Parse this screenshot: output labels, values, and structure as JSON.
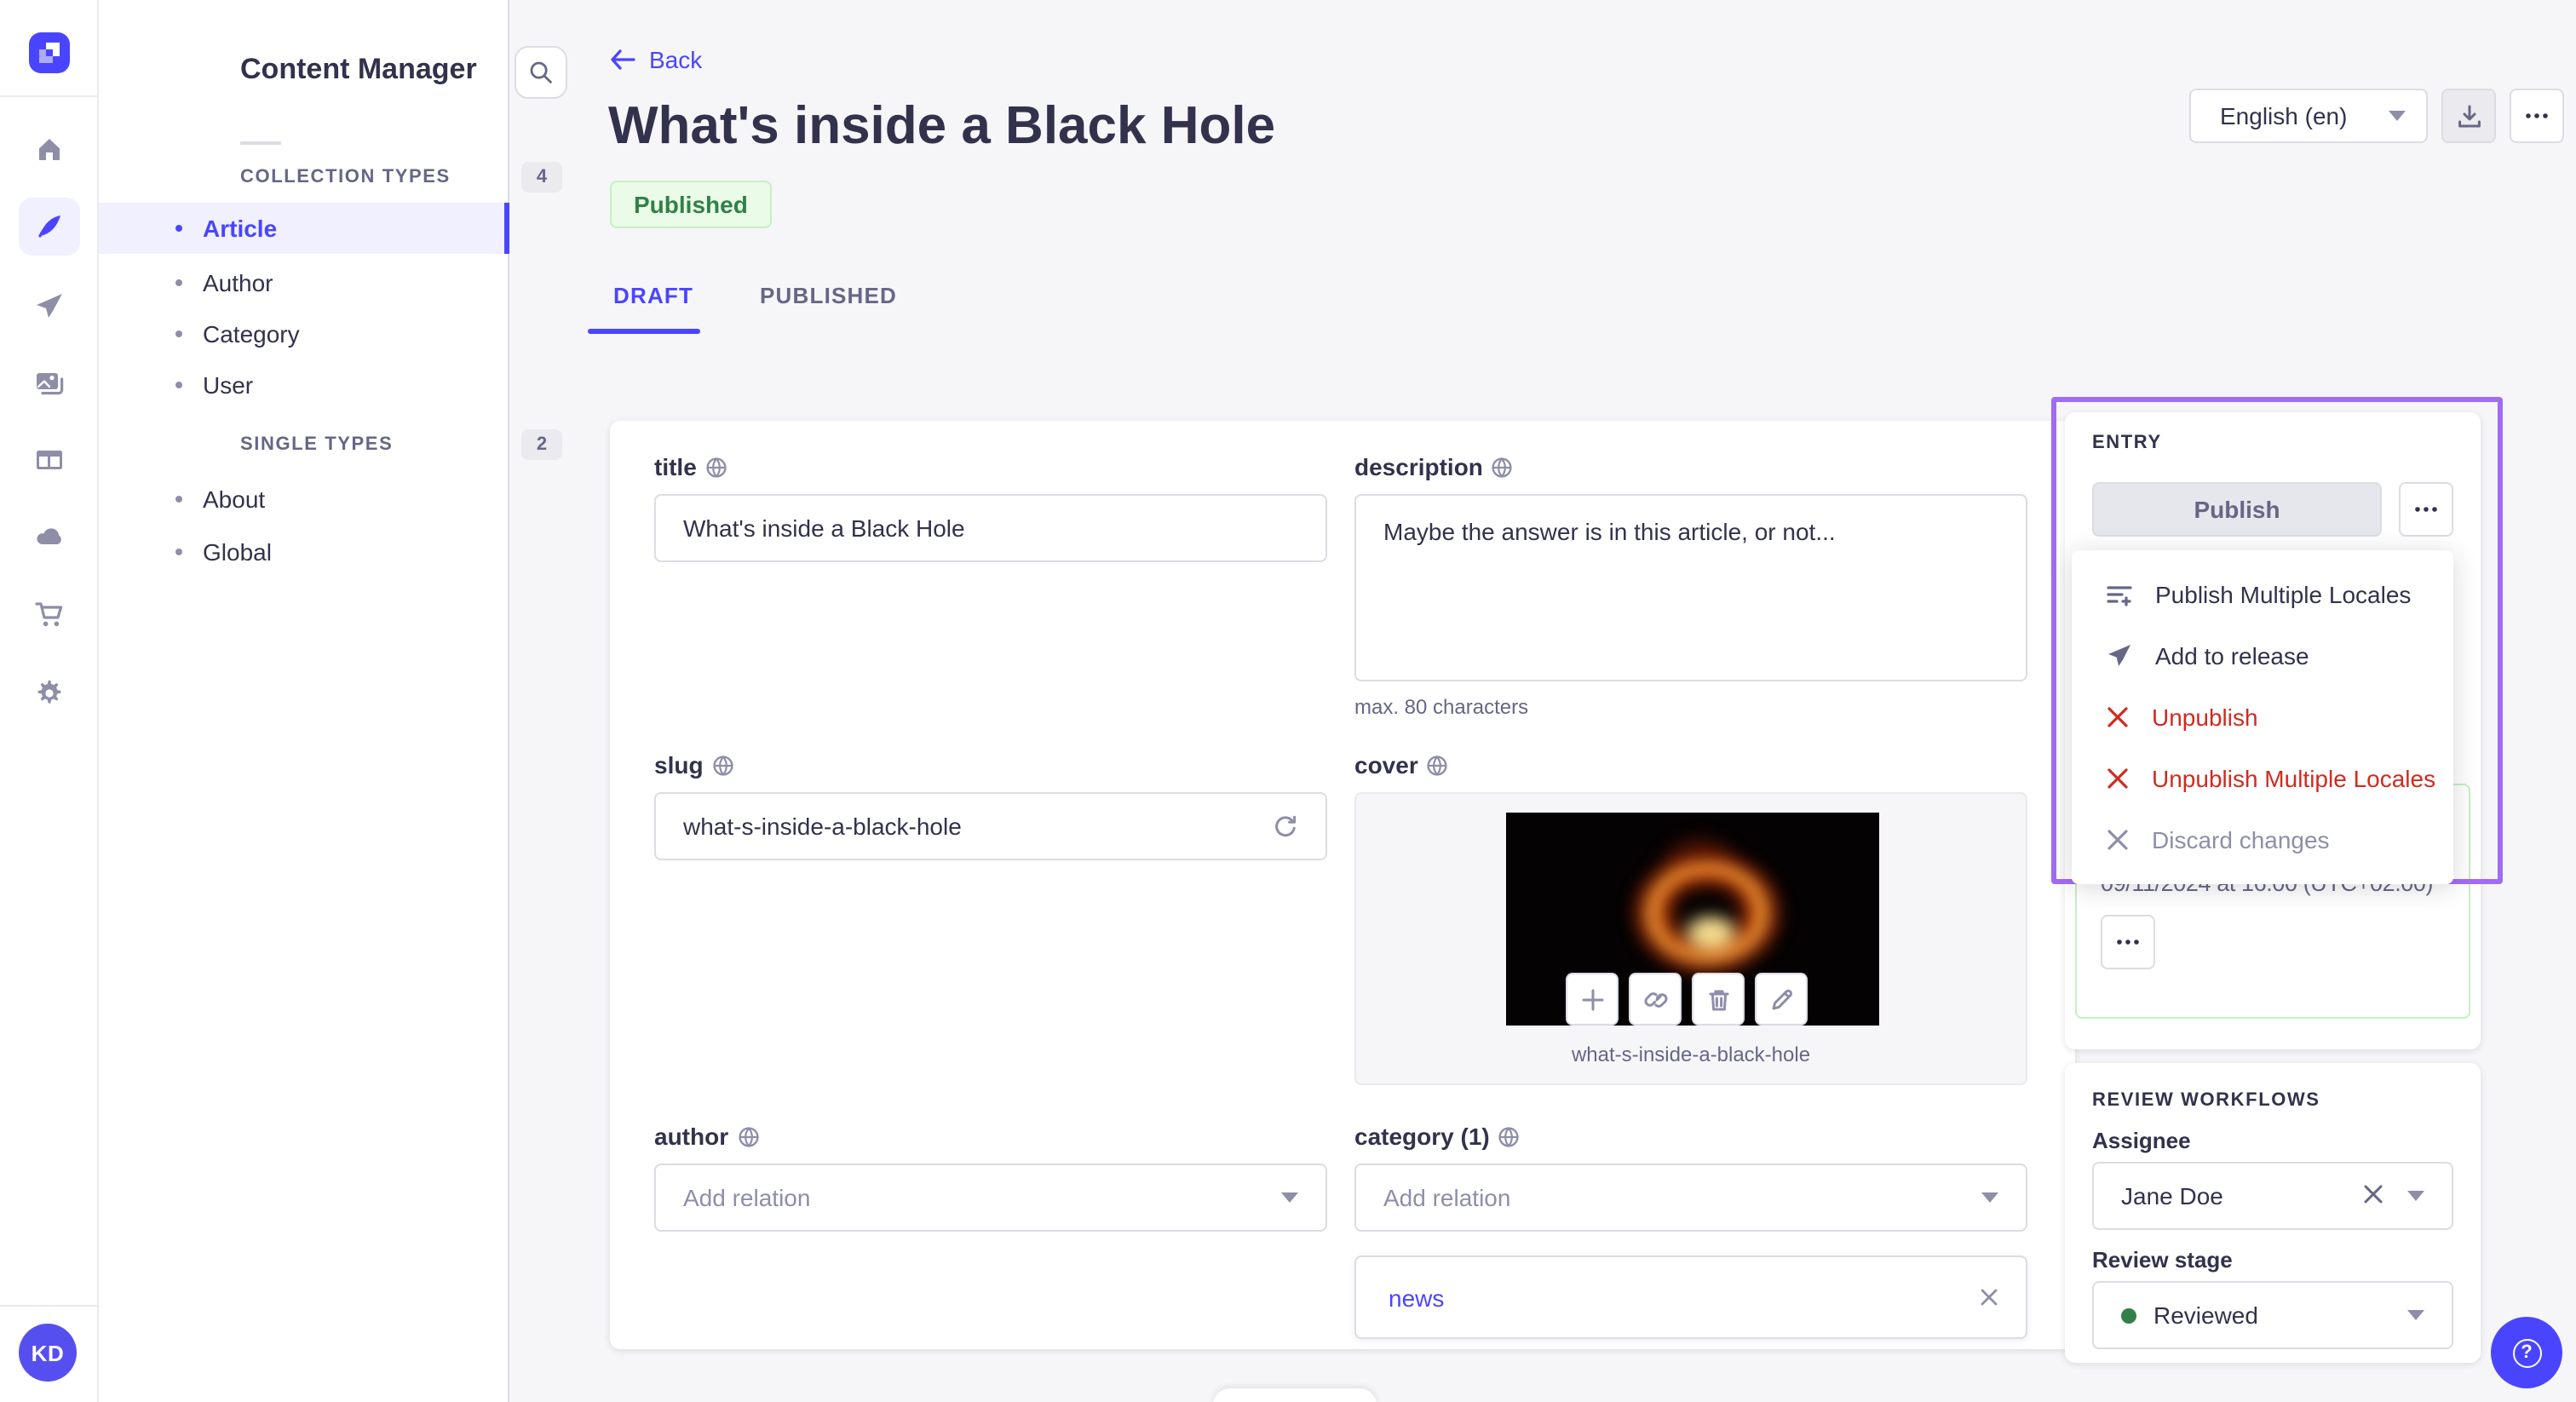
{
  "colors": {
    "accent": "#4945ff",
    "danger": "#d02b20",
    "success": "#328048",
    "highlight_border": "#a26bf5",
    "success_bg": "#eafbe7"
  },
  "rail": {
    "items": [
      "home-icon",
      "content-manager-icon",
      "releases-icon",
      "media-library-icon",
      "content-type-builder-icon",
      "deploy-icon",
      "marketplace-icon",
      "settings-icon"
    ],
    "active_item": "content-manager-icon",
    "avatar_initials": "KD"
  },
  "subnav": {
    "title": "Content Manager",
    "sections": [
      {
        "label": "COLLECTION TYPES",
        "count": "4",
        "items": [
          {
            "label": "Article"
          },
          {
            "label": "Author"
          },
          {
            "label": "Category"
          },
          {
            "label": "User"
          }
        ]
      },
      {
        "label": "SINGLE TYPES",
        "count": "2",
        "items": [
          {
            "label": "About"
          },
          {
            "label": "Global"
          }
        ]
      }
    ],
    "active_item": "Article"
  },
  "header": {
    "back_label": "Back",
    "title": "What's inside a Black Hole",
    "status_badge": "Published",
    "locale_select": "English (en)",
    "more_label": "⋯"
  },
  "tabs": {
    "draft": "DRAFT",
    "published": "PUBLISHED"
  },
  "form": {
    "title": {
      "label": "title",
      "value": "What's inside a Black Hole"
    },
    "description": {
      "label": "description",
      "value": "Maybe the answer is in this article, or not...",
      "helper": "max. 80 characters"
    },
    "slug": {
      "label": "slug",
      "value": "what-s-inside-a-black-hole"
    },
    "cover": {
      "label": "cover",
      "caption": "what-s-inside-a-black-hole"
    },
    "author": {
      "label": "author",
      "placeholder": "Add relation"
    },
    "category": {
      "label": "category (1)",
      "placeholder": "Add relation",
      "relations": [
        {
          "label": "news"
        }
      ]
    }
  },
  "entry_panel": {
    "title": "ENTRY",
    "publish_button": "Publish",
    "more_label": "⋯",
    "menu": {
      "items": [
        {
          "label": "Publish Multiple Locales",
          "icon": "list-plus-icon"
        },
        {
          "label": "Add to release",
          "icon": "paper-plane-icon"
        },
        {
          "label": "Unpublish",
          "icon": "cross-icon"
        },
        {
          "label": "Unpublish Multiple Locales",
          "icon": "cross-icon"
        },
        {
          "label": "Discard changes",
          "icon": "cross-icon"
        }
      ]
    },
    "release": {
      "date_text": "09/11/2024 at 16:00 (UTC+02:00)",
      "more_label": "⋯"
    }
  },
  "review_panel": {
    "title": "REVIEW WORKFLOWS",
    "assignee": {
      "label": "Assignee",
      "value": "Jane Doe"
    },
    "review_stage": {
      "label": "Review stage",
      "value": "Reviewed"
    }
  }
}
